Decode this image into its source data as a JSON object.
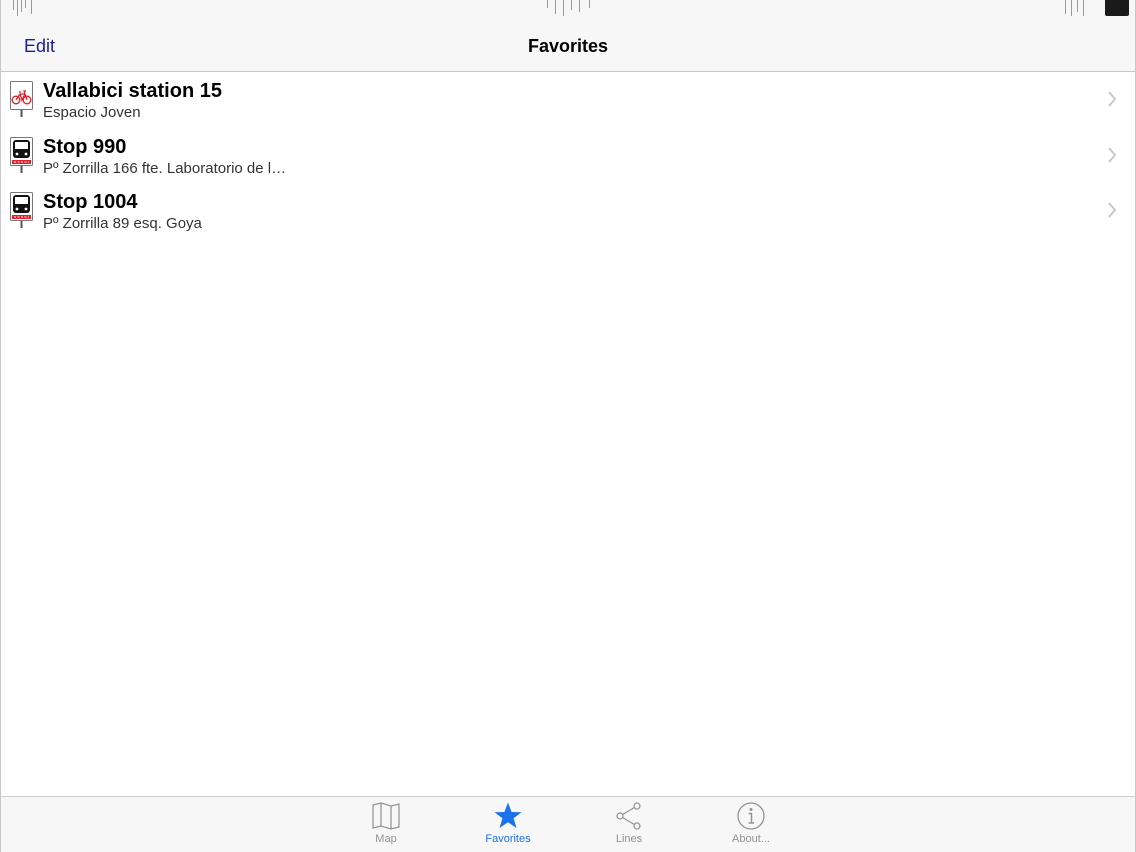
{
  "nav": {
    "title": "Favorites",
    "edit_label": "Edit"
  },
  "favorites": [
    {
      "icon": "bicycle-station-icon",
      "title": "Vallabici station 15",
      "subtitle": "Espacio Joven"
    },
    {
      "icon": "bus-stop-icon",
      "title": "Stop 990",
      "subtitle": "Pº Zorrilla 166 fte. Laboratorio de l…"
    },
    {
      "icon": "bus-stop-icon",
      "title": "Stop 1004",
      "subtitle": "Pº Zorrilla 89 esq. Goya"
    }
  ],
  "tabs": [
    {
      "label": "Map",
      "icon": "map-icon",
      "active": false
    },
    {
      "label": "Favorites",
      "icon": "star-icon",
      "active": true
    },
    {
      "label": "Lines",
      "icon": "share-lines-icon",
      "active": false
    },
    {
      "label": "About...",
      "icon": "info-icon",
      "active": false
    }
  ],
  "colors": {
    "accent": "#1a73e8",
    "edit": "#1a1aa8",
    "bus_stop_red": "#e0202a",
    "inactive_tab": "#929292"
  }
}
